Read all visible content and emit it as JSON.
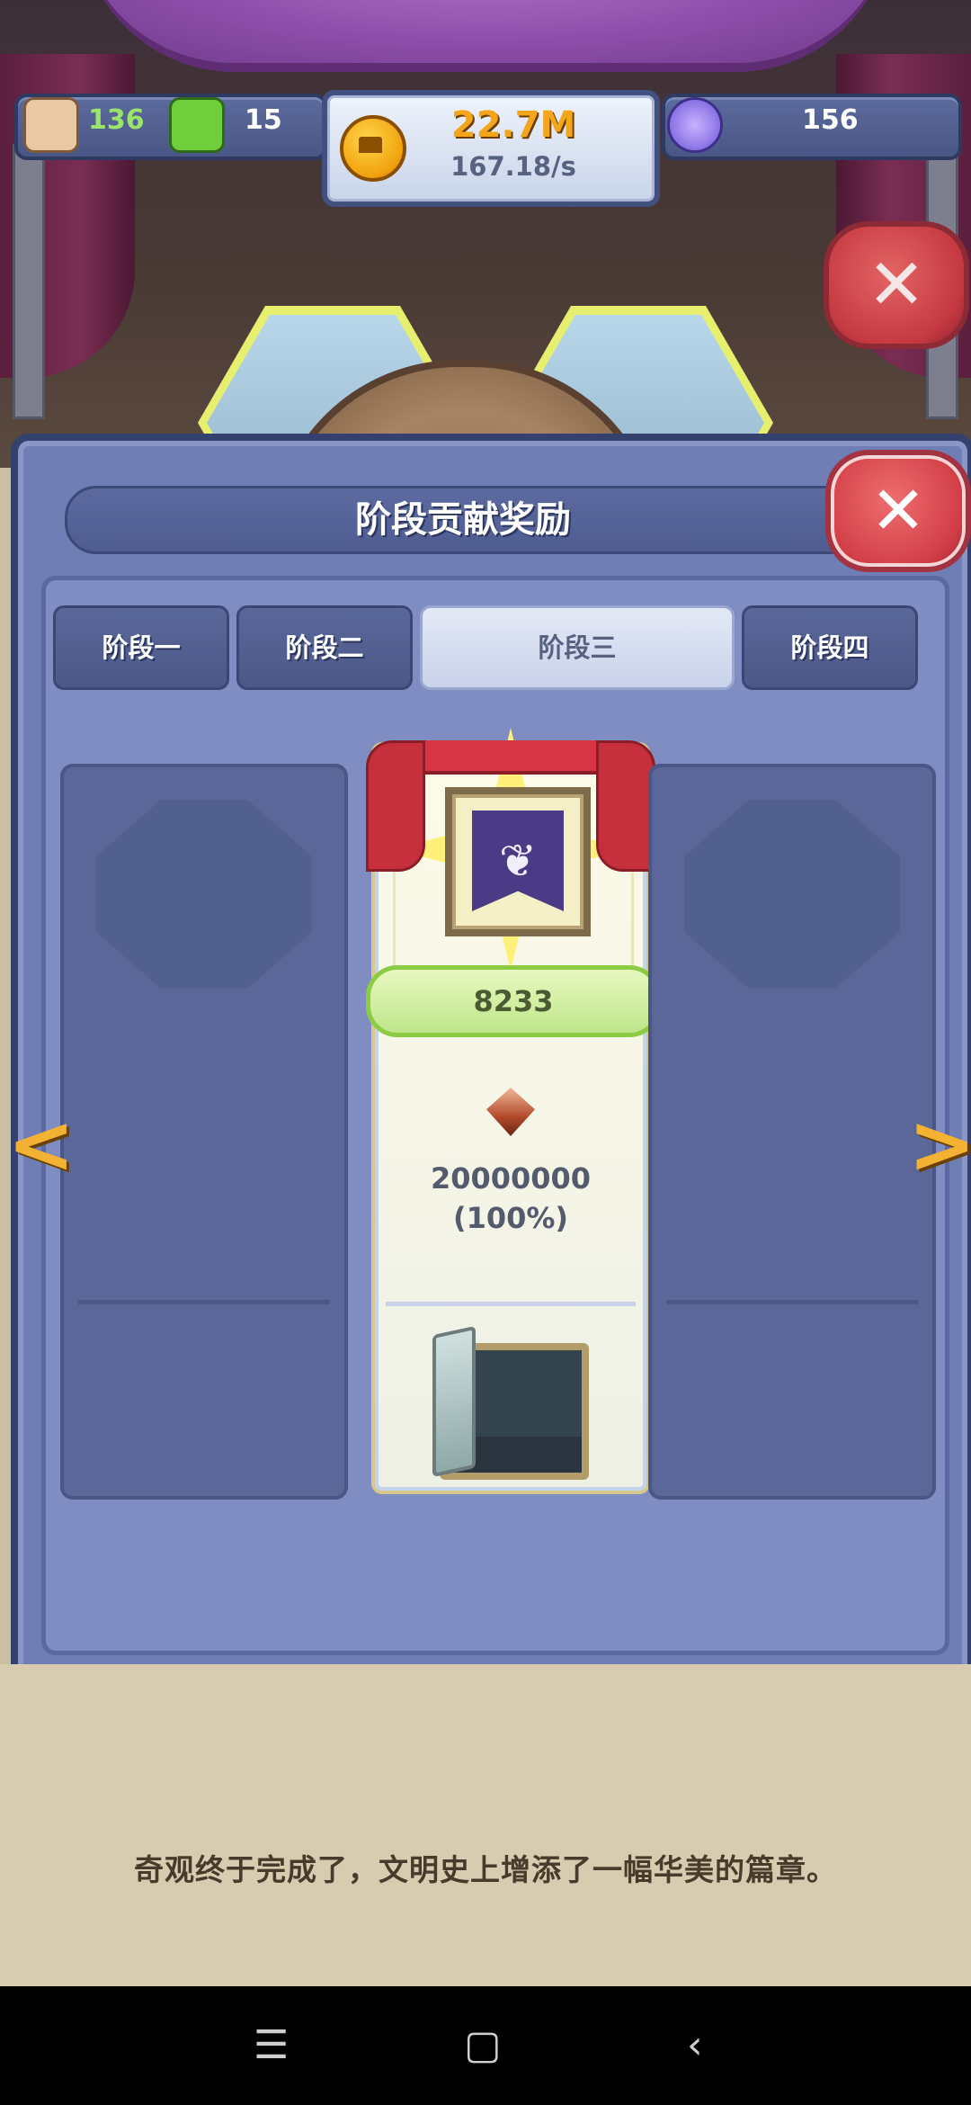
{
  "hud": {
    "population": "136",
    "happiness": "15",
    "gold_amount": "22.7M",
    "gold_rate": "167.18/s",
    "gems": "156"
  },
  "modal": {
    "title": "阶段贡献奖励",
    "tabs": [
      {
        "label": "阶段一",
        "active": false
      },
      {
        "label": "阶段二",
        "active": false
      },
      {
        "label": "阶段三",
        "active": true
      },
      {
        "label": "阶段四",
        "active": false
      }
    ],
    "reward_card": {
      "score": "8233",
      "requirement": "20000000",
      "progress": "(100%)"
    },
    "nav": {
      "prev": "<",
      "next": ">"
    }
  },
  "caption": "奇观终于完成了，文明史上增添了一幅华美的篇章。",
  "system_nav": {
    "menu": "☰",
    "home": "▢",
    "back": "‹"
  },
  "colors": {
    "accent_gold": "#f3a51b",
    "modal_bg": "#6f7eb4",
    "close_red": "#d23e47",
    "score_green": "#8dcb45"
  }
}
